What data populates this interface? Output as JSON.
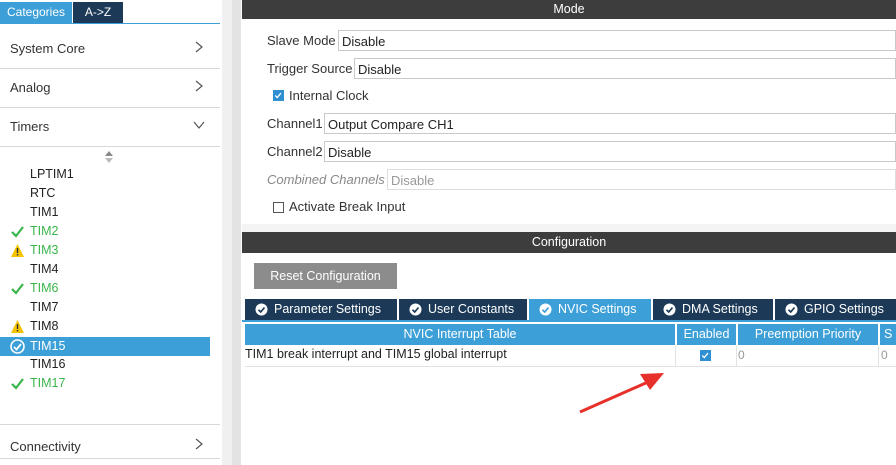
{
  "left": {
    "tabs": [
      "Categories",
      "A->Z"
    ],
    "sections": {
      "system_core": "System Core",
      "analog": "Analog",
      "timers": "Timers",
      "connectivity": "Connectivity"
    },
    "timers": [
      {
        "label": "LPTIM1",
        "status": "none"
      },
      {
        "label": "RTC",
        "status": "none"
      },
      {
        "label": "TIM1",
        "status": "none"
      },
      {
        "label": "TIM2",
        "status": "ok"
      },
      {
        "label": "TIM3",
        "status": "warning"
      },
      {
        "label": "TIM4",
        "status": "none"
      },
      {
        "label": "TIM6",
        "status": "ok"
      },
      {
        "label": "TIM7",
        "status": "none"
      },
      {
        "label": "TIM8",
        "status": "warning"
      },
      {
        "label": "TIM15",
        "status": "selected"
      },
      {
        "label": "TIM16",
        "status": "none"
      },
      {
        "label": "TIM17",
        "status": "ok"
      }
    ]
  },
  "mode": {
    "header": "Mode",
    "slave_mode": {
      "label": "Slave Mode",
      "value": "Disable"
    },
    "trigger_source": {
      "label": "Trigger Source",
      "value": "Disable"
    },
    "internal_clock": {
      "label": "Internal Clock",
      "checked": true
    },
    "channel1": {
      "label": "Channel1",
      "value": "Output Compare CH1"
    },
    "channel2": {
      "label": "Channel2",
      "value": "Disable"
    },
    "combined_channels": {
      "label": "Combined Channels",
      "value": "Disable"
    },
    "activate_break": {
      "label": "Activate Break Input",
      "checked": false
    }
  },
  "configuration": {
    "header": "Configuration",
    "reset_button": "Reset Configuration",
    "tabs": [
      "Parameter Settings",
      "User Constants",
      "NVIC Settings",
      "DMA Settings",
      "GPIO Settings"
    ],
    "active_tab": "NVIC Settings",
    "table": {
      "headers": [
        "NVIC Interrupt Table",
        "Enabled",
        "Preemption Priority",
        "S"
      ],
      "rows": [
        {
          "name": "TIM1 break interrupt and TIM15 global interrupt",
          "enabled": true,
          "preemption": "0",
          "sub": "0"
        }
      ]
    }
  },
  "colors": {
    "accent": "#3d9fd7",
    "dark_tab": "#1c3a57",
    "ok": "#39b54a",
    "warning": "#f5c400",
    "annotation_arrow": "#e8302a"
  }
}
